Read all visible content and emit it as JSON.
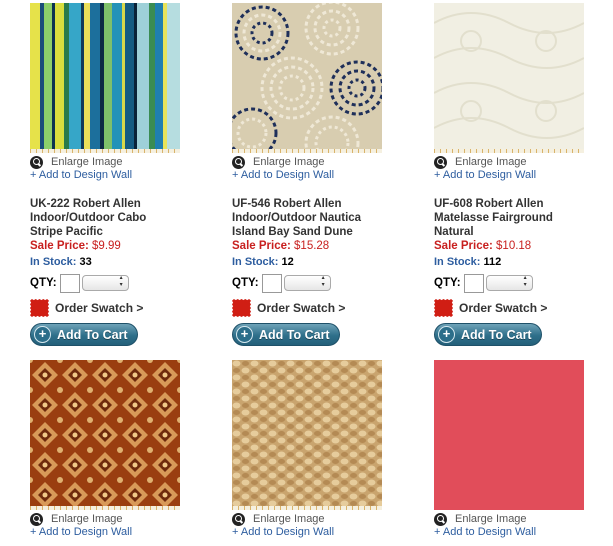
{
  "products": [
    {
      "title": "UK-222 Robert Allen Indoor/Outdoor Cabo Stripe Pacific",
      "sale_label": "Sale Price:",
      "sale_price": "$9.99",
      "stock_label": "In Stock:",
      "stock": "33",
      "swatch_icon": "fabric-stripe"
    },
    {
      "title": "UF-546 Robert Allen Indoor/Outdoor Nautica Island Bay Sand Dune",
      "sale_label": "Sale Price:",
      "sale_price": "$15.28",
      "stock_label": "In Stock:",
      "stock": "12",
      "swatch_icon": "fabric-rope-swirl"
    },
    {
      "title": "UF-608 Robert Allen Matelasse Fairground Natural",
      "sale_label": "Sale Price:",
      "sale_price": "$10.18",
      "stock_label": "In Stock:",
      "stock": "112",
      "swatch_icon": "fabric-matelasse"
    },
    {
      "swatch_icon": "fabric-medallion"
    },
    {
      "swatch_icon": "fabric-basketweave"
    },
    {
      "swatch_icon": "fabric-solid-coral"
    }
  ],
  "labels": {
    "enlarge": "Enlarge Image",
    "design_wall": "+ Add to Design Wall",
    "qty": "QTY:",
    "order_swatch": "Order Swatch >",
    "add_to_cart": "Add To Cart",
    "add_to_cart_icon": "+"
  },
  "colors": {
    "sale_red": "#c8201f",
    "link_blue": "#2d5d9f",
    "cart_teal": "#2e6f8a",
    "swatch_badge_red": "#d01e14"
  }
}
